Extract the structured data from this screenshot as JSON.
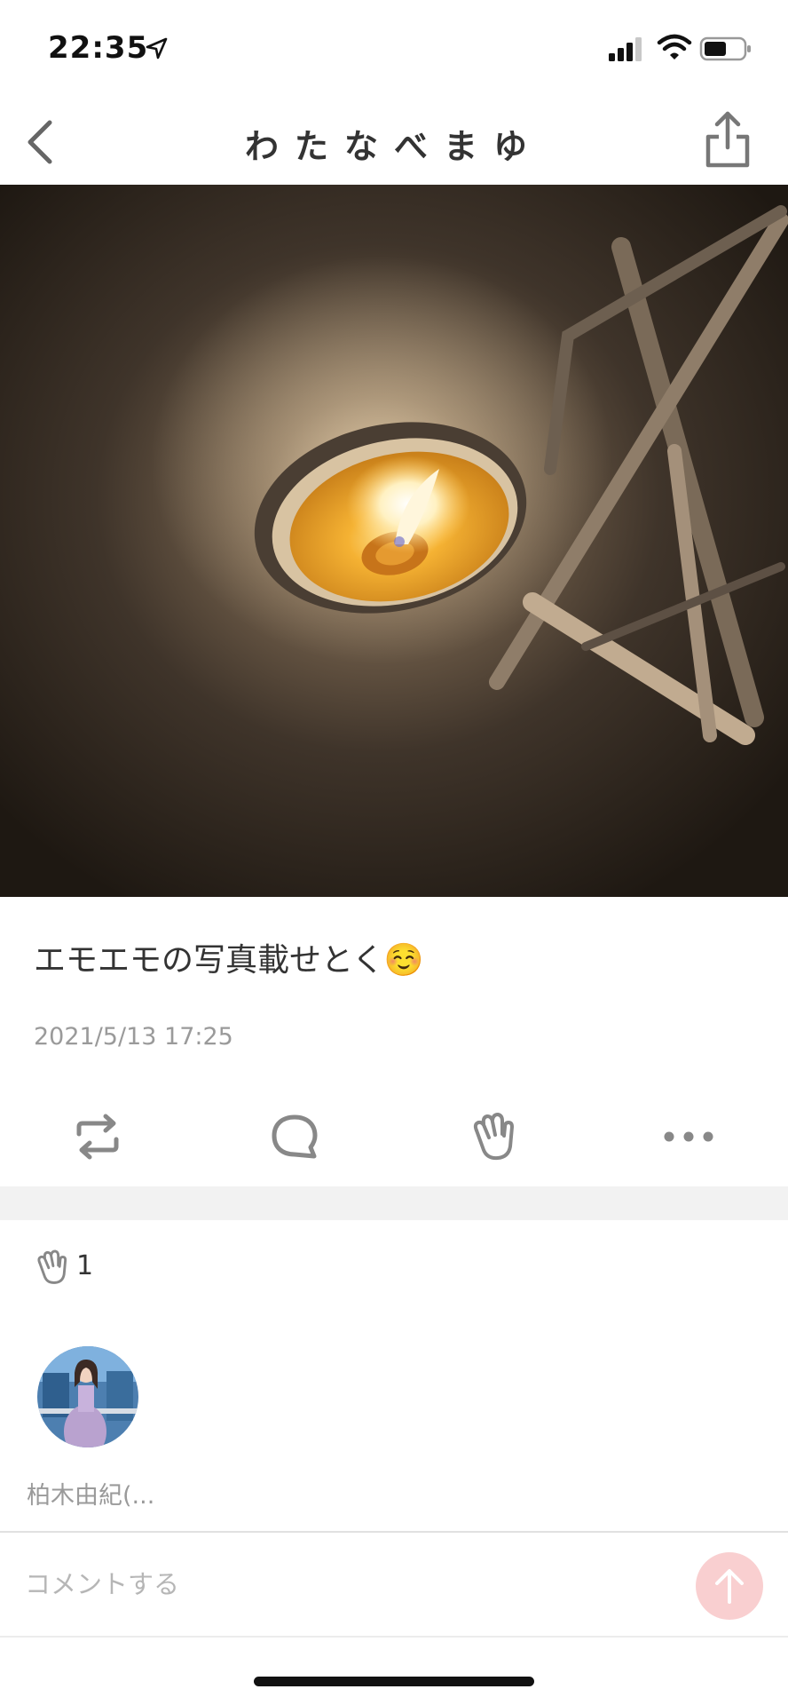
{
  "status_bar": {
    "time": "22:35"
  },
  "nav": {
    "title": "わたなべまゆ"
  },
  "post": {
    "text": "エモエモの写真載せとく☺️",
    "date": "2021/5/13 17:25"
  },
  "actions": [
    {
      "name": "repost",
      "icon": "repost-icon"
    },
    {
      "name": "comment",
      "icon": "comment-icon"
    },
    {
      "name": "clap",
      "icon": "clap-icon"
    },
    {
      "name": "more",
      "icon": "more-icon"
    }
  ],
  "claps": {
    "count": "1"
  },
  "clappers": [
    {
      "name": "柏木由紀(..."
    }
  ],
  "comment": {
    "placeholder": "コメントする"
  },
  "colors": {
    "send_button": "#f9cfd0",
    "text": "#333333",
    "muted": "#9a9a9a"
  }
}
